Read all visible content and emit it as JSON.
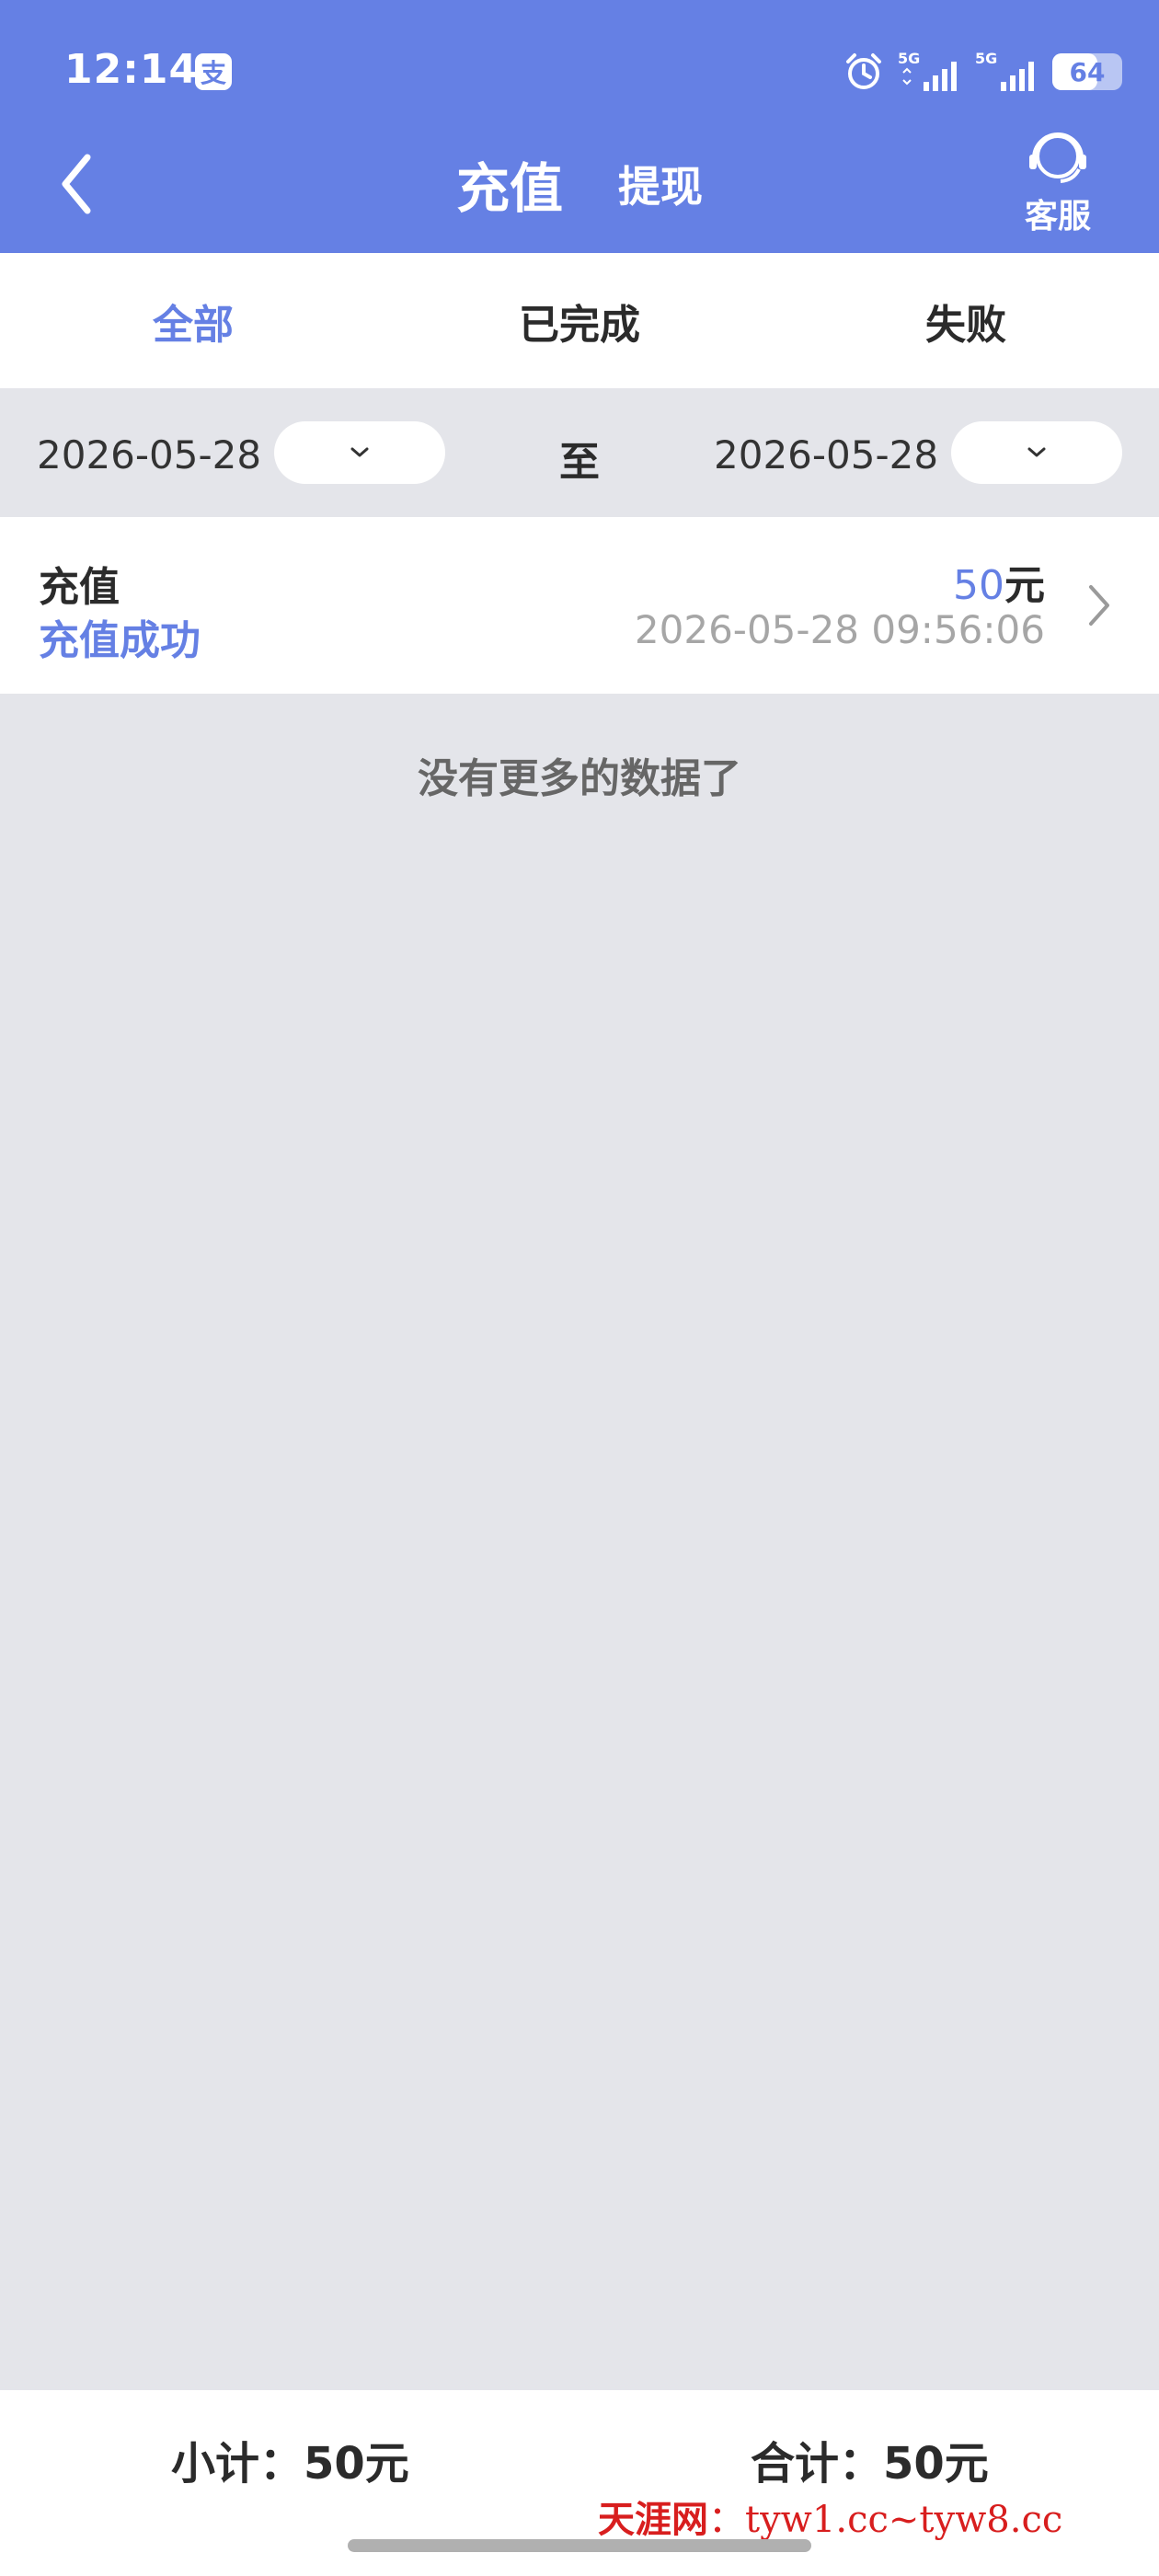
{
  "status_bar": {
    "time": "12:14",
    "battery": "64",
    "battery_level": 0.64,
    "signal_1_label": "5G",
    "signal_2_label": "5G"
  },
  "header": {
    "tab_recharge": "充值",
    "tab_withdraw": "提现",
    "customer_service": "客服"
  },
  "filters": {
    "tabs": [
      "全部",
      "已完成",
      "失败"
    ],
    "active_index": 0
  },
  "date_range": {
    "start": "2026-05-28",
    "to_label": "至",
    "end": "2026-05-28"
  },
  "records": [
    {
      "type": "充值",
      "status": "充值成功",
      "amount": "50",
      "unit": "元",
      "time": "2026-05-28 09:56:06"
    }
  ],
  "no_more": "没有更多的数据了",
  "footer": {
    "subtotal": "小计：50元",
    "total": "合计：50元"
  },
  "watermark": {
    "brand": "天涯网",
    "sep": "：",
    "sites": "tyw1.cc~tyw8.cc"
  },
  "colors": {
    "accent": "#6580e4",
    "background": "#e4e5ea",
    "watermark": "#d81e1e"
  }
}
